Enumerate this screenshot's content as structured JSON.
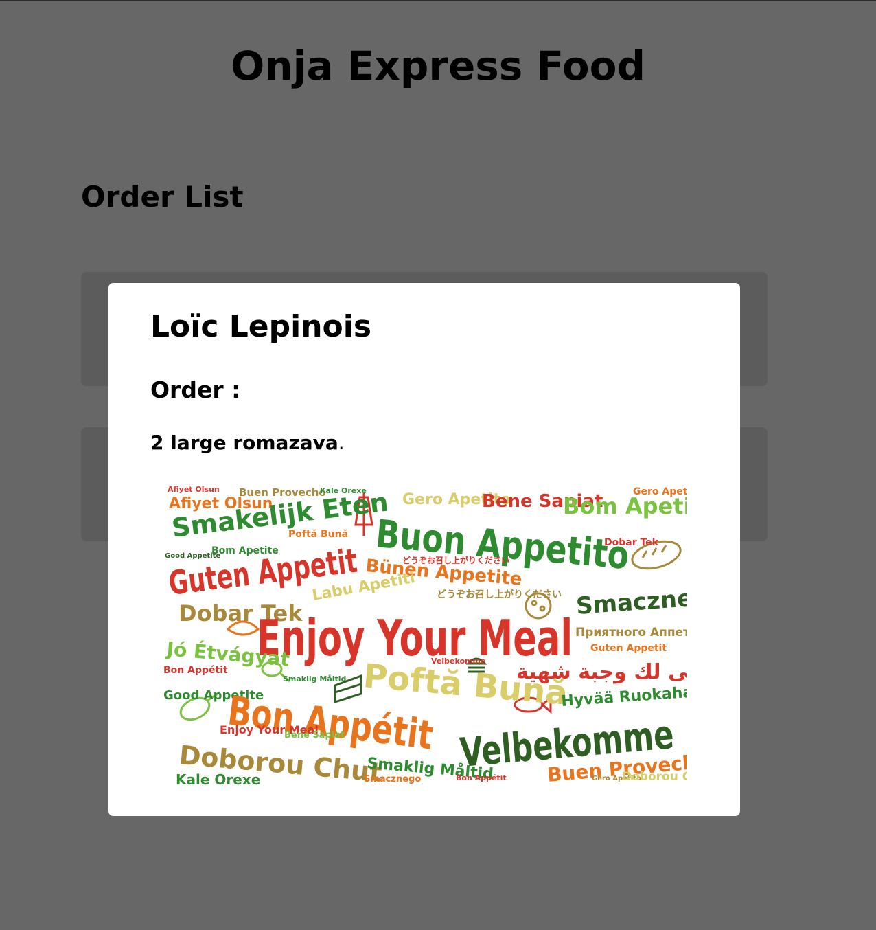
{
  "app": {
    "title": "Onja Express Food"
  },
  "orders_section": {
    "title": "Order List"
  },
  "modal": {
    "customer_name": "Loïc Lepinois",
    "order_label": "Order :",
    "order_description": "2 large romazava",
    "order_punctuation": ".",
    "image": {
      "type": "word-cloud",
      "palette": [
        "#d7342a",
        "#e8741e",
        "#2e8b30",
        "#7cc241",
        "#a8893a",
        "#d9cd6a",
        "#2f5e22"
      ],
      "words": [
        "Afiyet Olsun",
        "Buen Provecho",
        "Kale Orexe",
        "Gero Apetito",
        "Bene Sapiat",
        "Bom Apetite",
        "Buon Appetito",
        "Smakelijk Eten",
        "Poftă Bună",
        "Bom Apetite",
        "Good Appetite",
        "Guten Appetit",
        "Bünen Appetite",
        "Dobar Tek",
        "Labu Apetiti",
        "Smacznego",
        "Dobar Tek",
        "Enjoy Your Meal",
        "Приятного Аппетита",
        "Guten Appetit",
        "Jó Étvágyat",
        "Bon Appétit",
        "Good Appetite",
        "Poftă Bună",
        "أتمنى لك وجبة شهية",
        "Velbekomme",
        "Smaklig Måltid",
        "Hyvää Ruokahaluaa",
        "Bon Appétit",
        "Enjoy Your Meal",
        "Doborou Chut",
        "Kale Orexe",
        "Bene Sapiat",
        "Smaklig Måltid",
        "Smacznego",
        "Bon Appétit",
        "Velbekomme",
        "Buen Provecho",
        "Gero Apetito",
        "Doborou Chut",
        "どうぞお召し上がりください"
      ]
    }
  }
}
